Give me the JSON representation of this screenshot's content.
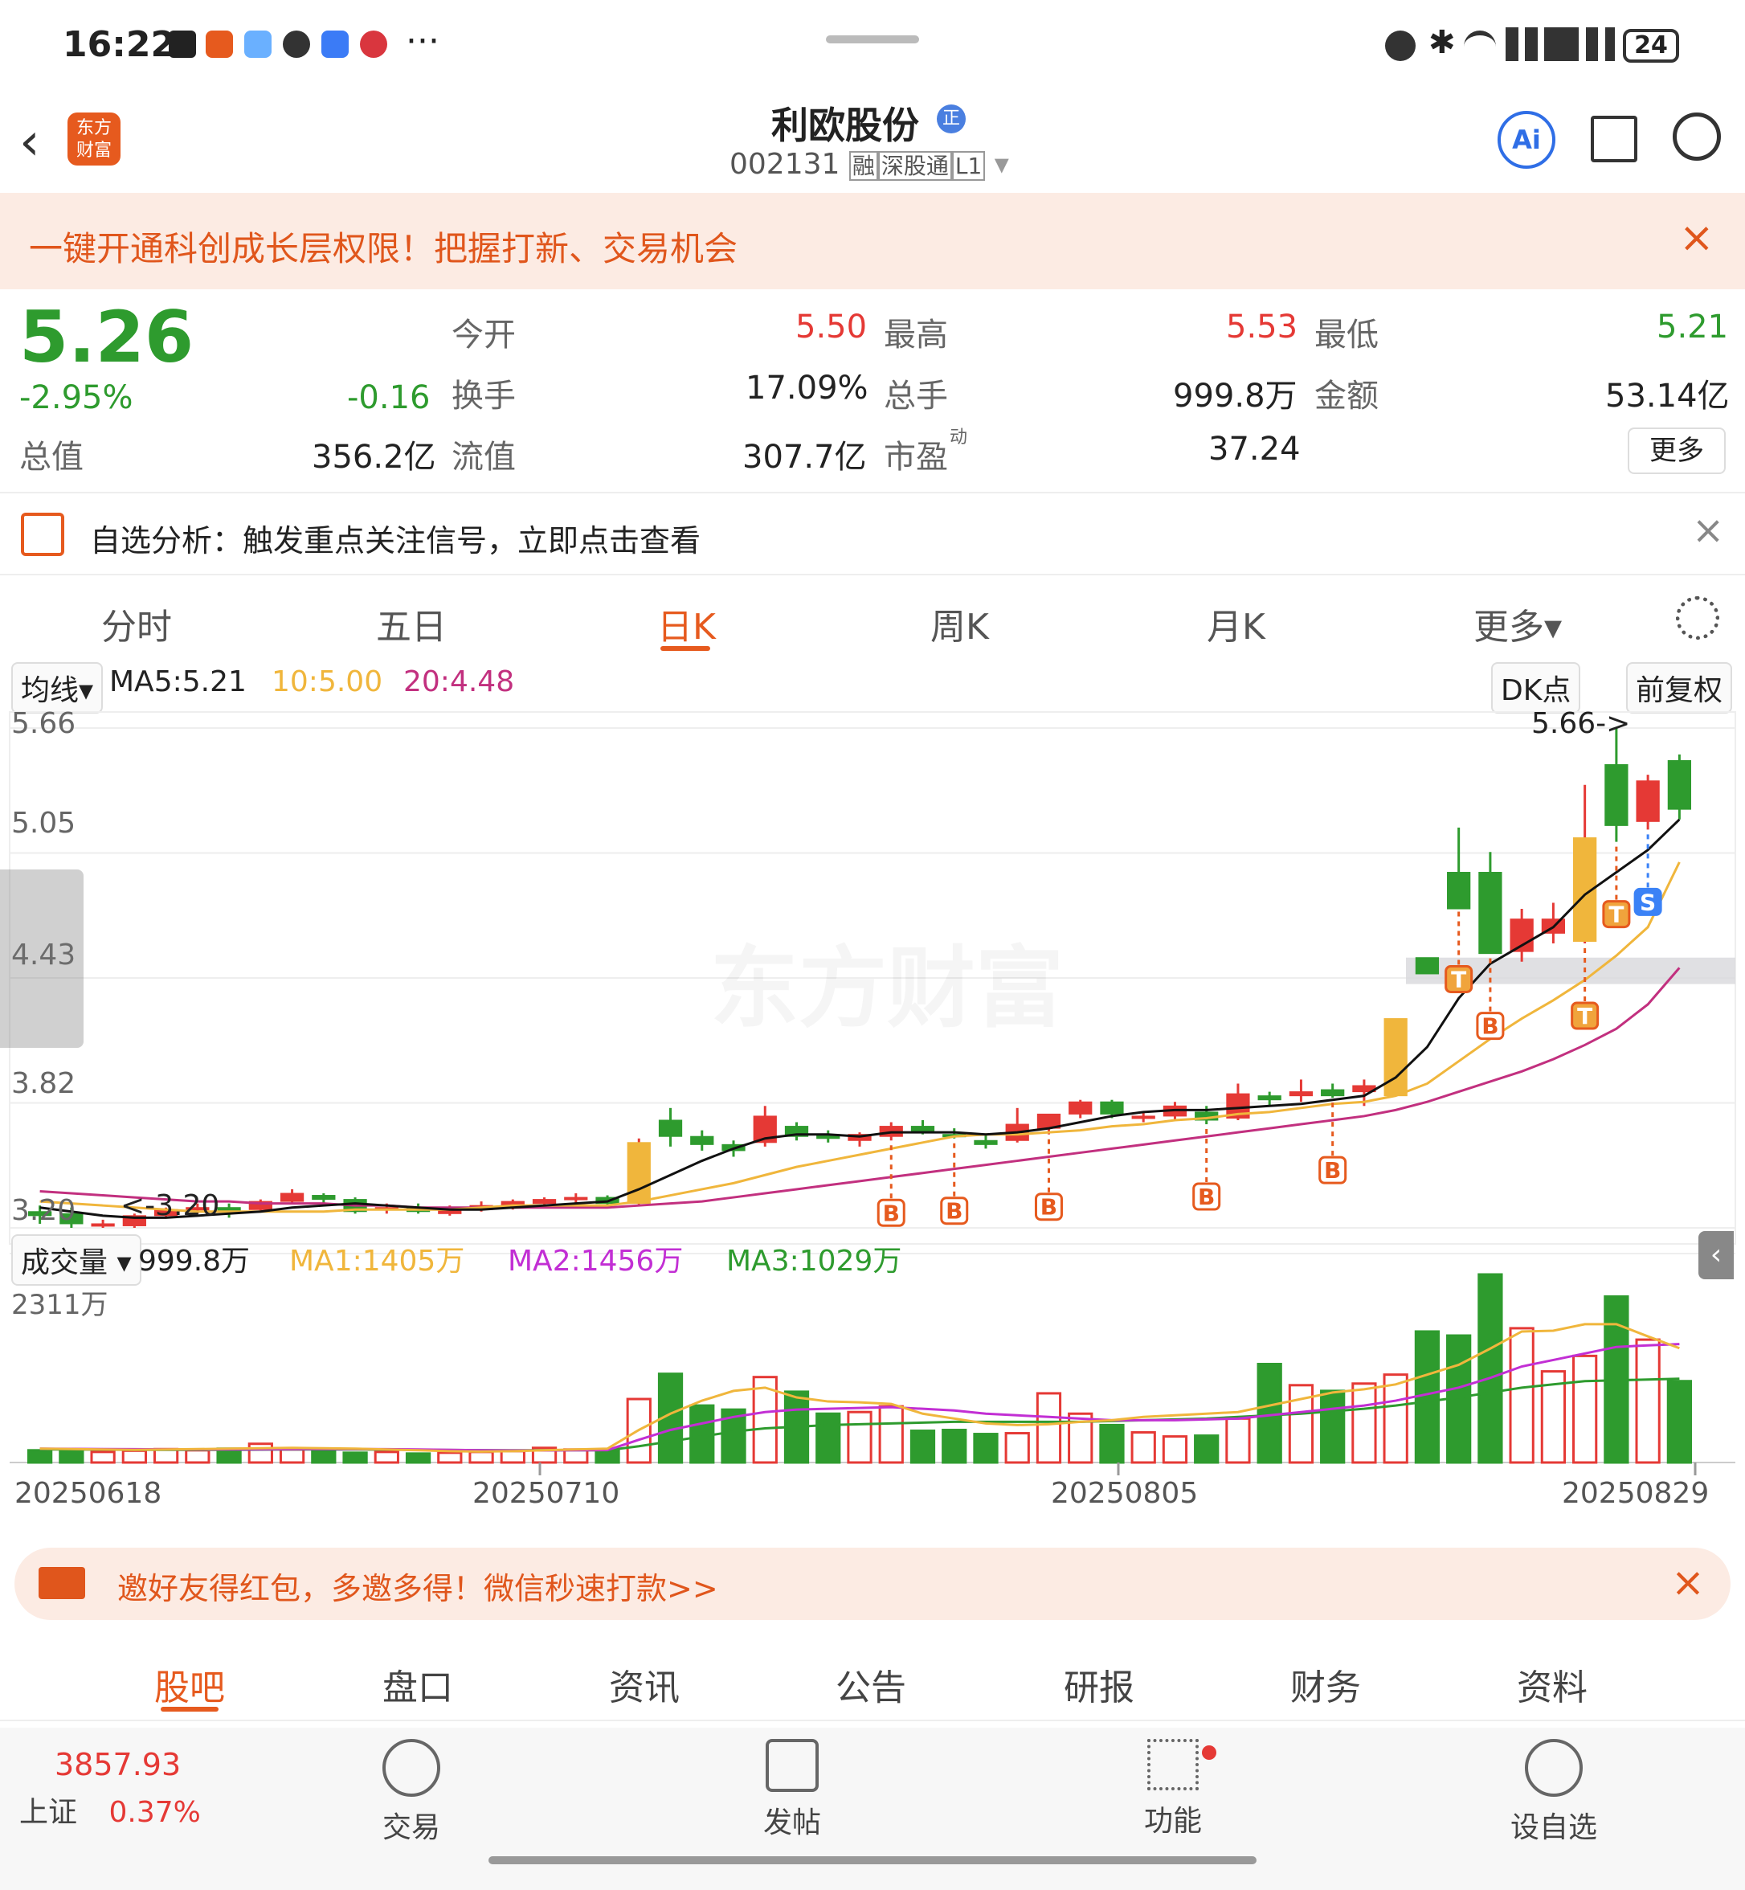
{
  "status_bar": {
    "time": "16:22",
    "notif_more": "···",
    "battery": "24"
  },
  "header": {
    "brand_line1": "东方",
    "brand_line2": "财富",
    "stock_name": "利欧股份",
    "badge": "正",
    "code": "002131",
    "tags": [
      "融",
      "深股通",
      "L1"
    ],
    "ai_label": "Ai"
  },
  "promo_banner": {
    "text": "一键开通科创成长层权限！把握打新、交易机会"
  },
  "quote": {
    "price": "5.26",
    "change_pct": "-2.95%",
    "change": "-0.16",
    "open_label": "今开",
    "open": "5.50",
    "high_label": "最高",
    "high": "5.53",
    "low_label": "最低",
    "low": "5.21",
    "turnover_label": "换手",
    "turnover": "17.09%",
    "volume_label": "总手",
    "volume": "999.8万",
    "amount_label": "金额",
    "amount": "53.14亿",
    "mktcap_label": "总值",
    "mktcap": "356.2亿",
    "float_label": "流值",
    "float": "307.7亿",
    "pe_label": "市盈",
    "pe_sup": "动",
    "pe": "37.24",
    "more_button": "更多"
  },
  "notice": {
    "text": "自选分析：触发重点关注信号，立即点击查看"
  },
  "period_tabs": [
    {
      "label": "分时"
    },
    {
      "label": "五日"
    },
    {
      "label": "日K"
    },
    {
      "label": "周K"
    },
    {
      "label": "月K"
    },
    {
      "label": "更多▾"
    }
  ],
  "ma_bar": {
    "dropdown": "均线▾",
    "ma5": "MA5:5.21",
    "ma10": "10:5.00",
    "ma20": "20:4.48",
    "dk": "DK点",
    "adjust": "前复权"
  },
  "price_axis": [
    "5.66",
    "5.05",
    "4.43",
    "3.82",
    "3.20"
  ],
  "annotations": {
    "max_label": "5.66->",
    "min_label": "<-3.20"
  },
  "watermark": "东方财富",
  "volume_bar": {
    "dropdown": "成交量 ▾",
    "vol": "999.8万",
    "ma1": "MA1:1405万",
    "ma2": "MA2:1456万",
    "ma3": "MA3:1029万",
    "axis_max": "2311万"
  },
  "date_axis": [
    "20250618",
    "20250710",
    "20250805",
    "20250829"
  ],
  "invite_banner": {
    "text": "邀好友得红包，多邀多得！微信秒速打款>>"
  },
  "bottom_tabs": [
    {
      "label": "股吧"
    },
    {
      "label": "盘口"
    },
    {
      "label": "资讯"
    },
    {
      "label": "公告"
    },
    {
      "label": "研报"
    },
    {
      "label": "财务"
    },
    {
      "label": "资料"
    }
  ],
  "dock": {
    "index_value": "3857.93",
    "index_name": "上证",
    "index_pct": "0.37%",
    "trade": "交易",
    "post": "发帖",
    "func": "功能",
    "watch": "设自选"
  },
  "colors": {
    "up": "#e53935",
    "down": "#2e9b2e",
    "accent": "#e65a1e",
    "ma5": "#111111",
    "ma10": "#f0b63c",
    "ma20": "#c2307f",
    "vol_ma1": "#f0b63c",
    "vol_ma2": "#c22fd4",
    "vol_ma3": "#2e9b2e"
  },
  "chart_data": {
    "type": "candlestick",
    "ylim": [
      3.2,
      5.66
    ],
    "volume_max": 2311,
    "candles": [
      {
        "o": 3.28,
        "h": 3.31,
        "l": 3.22,
        "c": 3.26
      },
      {
        "o": 3.27,
        "h": 3.3,
        "l": 3.2,
        "c": 3.22
      },
      {
        "o": 3.21,
        "h": 3.24,
        "l": 3.2,
        "c": 3.22
      },
      {
        "o": 3.21,
        "h": 3.27,
        "l": 3.2,
        "c": 3.26
      },
      {
        "o": 3.26,
        "h": 3.3,
        "l": 3.25,
        "c": 3.29
      },
      {
        "o": 3.29,
        "h": 3.32,
        "l": 3.27,
        "c": 3.3
      },
      {
        "o": 3.3,
        "h": 3.32,
        "l": 3.25,
        "c": 3.28
      },
      {
        "o": 3.29,
        "h": 3.34,
        "l": 3.28,
        "c": 3.33
      },
      {
        "o": 3.33,
        "h": 3.39,
        "l": 3.32,
        "c": 3.37
      },
      {
        "o": 3.36,
        "h": 3.37,
        "l": 3.32,
        "c": 3.34
      },
      {
        "o": 3.34,
        "h": 3.35,
        "l": 3.27,
        "c": 3.28
      },
      {
        "o": 3.29,
        "h": 3.32,
        "l": 3.27,
        "c": 3.3
      },
      {
        "o": 3.3,
        "h": 3.32,
        "l": 3.27,
        "c": 3.28
      },
      {
        "o": 3.27,
        "h": 3.31,
        "l": 3.26,
        "c": 3.29
      },
      {
        "o": 3.29,
        "h": 3.33,
        "l": 3.28,
        "c": 3.31
      },
      {
        "o": 3.3,
        "h": 3.34,
        "l": 3.29,
        "c": 3.33
      },
      {
        "o": 3.32,
        "h": 3.35,
        "l": 3.31,
        "c": 3.34
      },
      {
        "o": 3.34,
        "h": 3.37,
        "l": 3.32,
        "c": 3.35
      },
      {
        "o": 3.35,
        "h": 3.36,
        "l": 3.31,
        "c": 3.32
      },
      {
        "o": 3.32,
        "h": 3.64,
        "l": 3.31,
        "c": 3.62
      },
      {
        "o": 3.73,
        "h": 3.79,
        "l": 3.6,
        "c": 3.65
      },
      {
        "o": 3.65,
        "h": 3.68,
        "l": 3.58,
        "c": 3.61
      },
      {
        "o": 3.61,
        "h": 3.63,
        "l": 3.55,
        "c": 3.58
      },
      {
        "o": 3.62,
        "h": 3.8,
        "l": 3.6,
        "c": 3.75
      },
      {
        "o": 3.7,
        "h": 3.72,
        "l": 3.63,
        "c": 3.65
      },
      {
        "o": 3.66,
        "h": 3.68,
        "l": 3.62,
        "c": 3.64
      },
      {
        "o": 3.63,
        "h": 3.67,
        "l": 3.6,
        "c": 3.66
      },
      {
        "o": 3.65,
        "h": 3.72,
        "l": 3.63,
        "c": 3.7
      },
      {
        "o": 3.7,
        "h": 3.73,
        "l": 3.66,
        "c": 3.67
      },
      {
        "o": 3.66,
        "h": 3.69,
        "l": 3.64,
        "c": 3.65
      },
      {
        "o": 3.63,
        "h": 3.66,
        "l": 3.59,
        "c": 3.61
      },
      {
        "o": 3.63,
        "h": 3.79,
        "l": 3.62,
        "c": 3.71
      },
      {
        "o": 3.69,
        "h": 3.76,
        "l": 3.66,
        "c": 3.76
      },
      {
        "o": 3.76,
        "h": 3.83,
        "l": 3.74,
        "c": 3.82
      },
      {
        "o": 3.82,
        "h": 3.83,
        "l": 3.74,
        "c": 3.76
      },
      {
        "o": 3.74,
        "h": 3.77,
        "l": 3.72,
        "c": 3.75
      },
      {
        "o": 3.75,
        "h": 3.82,
        "l": 3.73,
        "c": 3.8
      },
      {
        "o": 3.77,
        "h": 3.8,
        "l": 3.71,
        "c": 3.73
      },
      {
        "o": 3.74,
        "h": 3.91,
        "l": 3.73,
        "c": 3.86
      },
      {
        "o": 3.85,
        "h": 3.87,
        "l": 3.8,
        "c": 3.83
      },
      {
        "o": 3.85,
        "h": 3.93,
        "l": 3.82,
        "c": 3.87
      },
      {
        "o": 3.88,
        "h": 3.91,
        "l": 3.84,
        "c": 3.85
      },
      {
        "o": 3.87,
        "h": 3.93,
        "l": 3.8,
        "c": 3.9
      },
      {
        "o": 3.85,
        "h": 4.23,
        "l": 3.85,
        "c": 4.23
      },
      {
        "o": 4.53,
        "h": 4.53,
        "l": 4.45,
        "c": 4.45
      },
      {
        "o": 4.95,
        "h": 5.17,
        "l": 4.78,
        "c": 4.77
      },
      {
        "o": 4.95,
        "h": 5.05,
        "l": 4.55,
        "c": 4.55
      },
      {
        "o": 4.56,
        "h": 4.77,
        "l": 4.51,
        "c": 4.72
      },
      {
        "o": 4.65,
        "h": 4.8,
        "l": 4.6,
        "c": 4.72
      },
      {
        "o": 4.61,
        "h": 5.38,
        "l": 4.6,
        "c": 5.12
      },
      {
        "o": 5.48,
        "h": 5.66,
        "l": 5.1,
        "c": 5.18
      },
      {
        "o": 5.2,
        "h": 5.43,
        "l": 5.16,
        "c": 5.4
      },
      {
        "o": 5.5,
        "h": 5.53,
        "l": 5.21,
        "c": 5.26
      }
    ],
    "ma5": [
      3.3,
      3.28,
      3.26,
      3.25,
      3.25,
      3.26,
      3.27,
      3.28,
      3.3,
      3.31,
      3.32,
      3.31,
      3.3,
      3.29,
      3.29,
      3.3,
      3.31,
      3.32,
      3.33,
      3.39,
      3.46,
      3.53,
      3.59,
      3.64,
      3.66,
      3.66,
      3.65,
      3.67,
      3.67,
      3.67,
      3.66,
      3.67,
      3.69,
      3.72,
      3.75,
      3.77,
      3.78,
      3.78,
      3.79,
      3.8,
      3.81,
      3.83,
      3.85,
      3.94,
      4.09,
      4.33,
      4.5,
      4.59,
      4.68,
      4.84,
      4.95,
      5.06,
      5.21
    ],
    "ma10": [
      3.33,
      3.32,
      3.31,
      3.3,
      3.29,
      3.28,
      3.28,
      3.28,
      3.28,
      3.28,
      3.29,
      3.29,
      3.29,
      3.29,
      3.3,
      3.31,
      3.31,
      3.31,
      3.31,
      3.33,
      3.36,
      3.39,
      3.42,
      3.46,
      3.5,
      3.53,
      3.56,
      3.59,
      3.62,
      3.65,
      3.66,
      3.66,
      3.67,
      3.68,
      3.7,
      3.71,
      3.73,
      3.74,
      3.76,
      3.77,
      3.79,
      3.81,
      3.82,
      3.85,
      3.91,
      4.02,
      4.13,
      4.23,
      4.32,
      4.42,
      4.54,
      4.68,
      5.0
    ],
    "ma20": [
      3.38,
      3.37,
      3.36,
      3.35,
      3.34,
      3.33,
      3.33,
      3.32,
      3.32,
      3.32,
      3.31,
      3.31,
      3.3,
      3.3,
      3.3,
      3.3,
      3.3,
      3.3,
      3.3,
      3.31,
      3.32,
      3.33,
      3.35,
      3.37,
      3.39,
      3.41,
      3.43,
      3.45,
      3.47,
      3.49,
      3.51,
      3.53,
      3.55,
      3.57,
      3.59,
      3.61,
      3.63,
      3.65,
      3.67,
      3.69,
      3.71,
      3.73,
      3.75,
      3.78,
      3.82,
      3.87,
      3.92,
      3.97,
      4.03,
      4.1,
      4.18,
      4.3,
      4.48
    ],
    "volumes": [
      150,
      140,
      130,
      145,
      165,
      150,
      170,
      230,
      160,
      150,
      120,
      130,
      110,
      120,
      130,
      140,
      180,
      160,
      150,
      780,
      1090,
      700,
      650,
      1050,
      870,
      600,
      620,
      690,
      390,
      400,
      350,
      360,
      850,
      600,
      460,
      370,
      320,
      330,
      540,
      1210,
      950,
      880,
      970,
      1080,
      1610,
      1560,
      2311,
      1650,
      1120,
      1310,
      2040,
      1510,
      1000
    ],
    "vol_ma1": [
      170,
      165,
      160,
      155,
      160,
      165,
      170,
      175,
      180,
      175,
      170,
      160,
      150,
      140,
      135,
      140,
      150,
      160,
      170,
      400,
      600,
      760,
      880,
      920,
      800,
      750,
      740,
      720,
      600,
      540,
      480,
      460,
      470,
      500,
      520,
      560,
      580,
      600,
      620,
      700,
      780,
      860,
      900,
      960,
      1080,
      1200,
      1400,
      1610,
      1620,
      1700,
      1700,
      1550,
      1405
    ],
    "vol_ma2": [
      170,
      168,
      166,
      164,
      162,
      160,
      160,
      162,
      164,
      166,
      166,
      164,
      160,
      156,
      150,
      148,
      148,
      150,
      152,
      280,
      400,
      480,
      560,
      620,
      650,
      660,
      670,
      680,
      660,
      640,
      600,
      580,
      560,
      540,
      520,
      520,
      520,
      530,
      540,
      580,
      620,
      660,
      700,
      760,
      840,
      920,
      1040,
      1180,
      1260,
      1340,
      1420,
      1440,
      1456
    ],
    "vol_ma3": [
      160,
      160,
      158,
      156,
      156,
      156,
      156,
      158,
      160,
      160,
      160,
      158,
      156,
      154,
      152,
      150,
      150,
      150,
      150,
      200,
      260,
      320,
      380,
      420,
      440,
      460,
      470,
      480,
      490,
      500,
      500,
      500,
      500,
      500,
      510,
      520,
      530,
      540,
      560,
      580,
      600,
      630,
      660,
      700,
      750,
      800,
      860,
      920,
      960,
      1000,
      1010,
      1020,
      1029
    ],
    "signals": [
      {
        "i": 27,
        "label": "B"
      },
      {
        "i": 29,
        "label": "B"
      },
      {
        "i": 32,
        "label": "B"
      },
      {
        "i": 37,
        "label": "B"
      },
      {
        "i": 41,
        "label": "B"
      },
      {
        "i": 45,
        "label": "T"
      },
      {
        "i": 46,
        "label": "B"
      },
      {
        "i": 49,
        "label": "T"
      },
      {
        "i": 50,
        "label": "T"
      },
      {
        "i": 51,
        "label": "S"
      }
    ]
  }
}
